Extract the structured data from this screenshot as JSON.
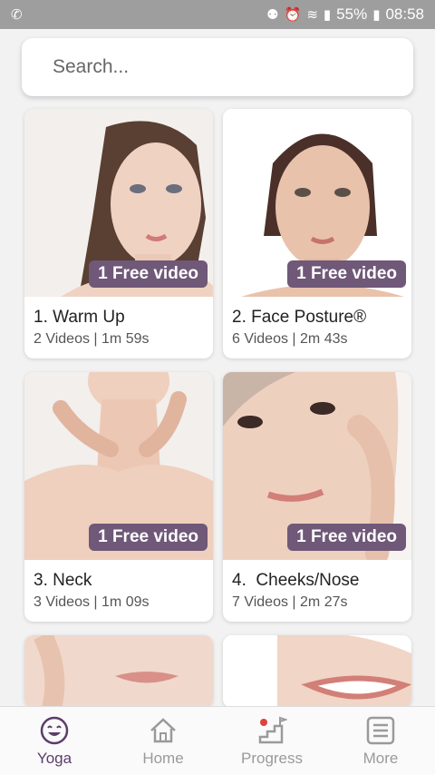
{
  "status": {
    "battery": "55%",
    "time": "08:58"
  },
  "search": {
    "placeholder": "Search..."
  },
  "cards": [
    {
      "badge": "1 Free video",
      "title": "1. Warm Up",
      "meta": "2 Videos | 1m 59s"
    },
    {
      "badge": "1 Free video",
      "title": "2. Face Posture®",
      "meta": "6 Videos | 2m 43s"
    },
    {
      "badge": "1 Free video",
      "title": "3. Neck",
      "meta": "3 Videos | 1m 09s"
    },
    {
      "badge": "1 Free video",
      "title": "4.  Cheeks/Nose",
      "meta": "7 Videos | 2m 27s"
    }
  ],
  "nav": [
    {
      "label": "Yoga",
      "icon": "smile-icon",
      "active": true
    },
    {
      "label": "Home",
      "icon": "home-icon",
      "active": false
    },
    {
      "label": "Progress",
      "icon": "stairs-flag-icon",
      "active": false
    },
    {
      "label": "More",
      "icon": "menu-icon",
      "active": false
    }
  ],
  "colors": {
    "accent": "#5c3d6b",
    "badge": "#6f5878",
    "statusbar": "#9e9e9e"
  }
}
